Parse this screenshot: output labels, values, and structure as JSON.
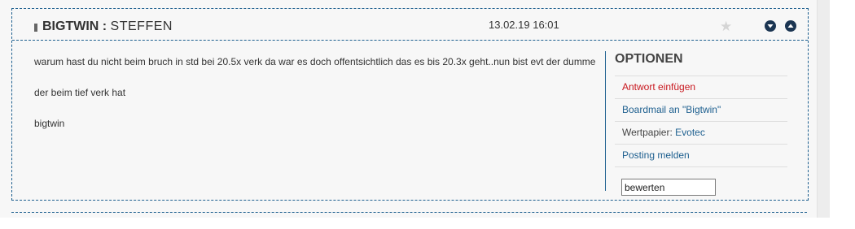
{
  "post": {
    "author_name": "BIGTWIN",
    "author_sep": " : ",
    "author_rank": "STEFFEN",
    "date": "13.02.19 16:01",
    "paragraphs": [
      "warum hast du nicht beim bruch in std bei 20.5x verk   da war es doch offentsichtlich das es bis 20.3x geht..nun bist evt der dumme",
      "der beim tief verk hat",
      "bigtwin"
    ],
    "icons": {
      "star": "star-icon",
      "down": "arrow-down-circle-icon",
      "up": "arrow-up-circle-icon"
    }
  },
  "options": {
    "title": "OPTIONEN",
    "reply": "Antwort einfügen",
    "boardmail": "Boardmail an \"Bigtwin\"",
    "wertpapier_label": "Wertpapier:",
    "wertpapier_value": "Evotec",
    "report": "Posting melden",
    "rate_value": "bewerten"
  },
  "colors": {
    "accent": "#1d5f8f",
    "reply_red": "#c8161d",
    "nav_button": "#1b3552"
  }
}
